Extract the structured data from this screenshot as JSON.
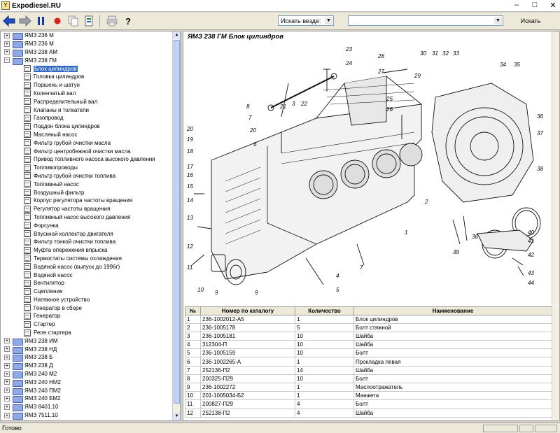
{
  "window": {
    "title": "Expodiesel.RU",
    "icon": "app-icon",
    "controls": [
      "minimize",
      "maximize",
      "close"
    ]
  },
  "toolbar": {
    "buttons": [
      "back-arrow-icon",
      "forward-arrow-icon",
      "pause-icon",
      "record-icon",
      "copy-icon",
      "sync-icon",
      "print-icon",
      "help-icon"
    ],
    "search_scope_label": "Искать везде:",
    "search_value": "",
    "search_button": "Искать"
  },
  "tree": {
    "groups_before": [
      "ЯМЗ 236 М",
      "ЯМЗ 236 М",
      "ЯМЗ 238 АМ"
    ],
    "expanded_group": "ЯМЗ 238 ГМ",
    "children": [
      "Блок цилиндров",
      "Головка цилиндров",
      "Поршень и шатун",
      "Коленчатый вал",
      "Распределительный вал",
      "Клапаны и толкатели",
      "Газопровод",
      "Поддон блока цилиндров",
      "Масляный насос",
      "Фильтр грубой очистки масла",
      "Фильтр центробежной очистки масла",
      "Привод топливного насоса высокого давления",
      "Топливопроводы",
      "Фильтр грубой очистки топлива",
      "Топливный насос",
      "Воздушный фильтр",
      "Корпус регулятора частоты вращения",
      "Регулятор частоты вращения",
      "Топливный насос высокого давления",
      "Форсунка",
      "Впускной коллектор двигателя",
      "Фильтр тонкой очистки топлива",
      "Муфта опережения впрыска",
      "Термостаты системы охлаждения",
      "Водяной насос (выпуск до 1996г)",
      "Водяной насос",
      "Вентилятор",
      "Сцепление",
      "Натяжное устройство",
      "Генератор в сборе",
      "Генератор",
      "Стартер",
      "Реле стартера"
    ],
    "selected_index": 0,
    "groups_after": [
      "ЯМЗ 238 ИМ",
      "ЯМЗ 238 НД",
      "ЯМЗ 238 Б",
      "ЯМЗ 238 Д",
      "ЯМЗ 240 М2",
      "ЯМЗ 240 НМ2",
      "ЯМЗ 240 ПМ2",
      "ЯМЗ 240 БМ2",
      "ЯМЗ 8401.10",
      "ЯМЗ 7511.10"
    ]
  },
  "diagram": {
    "title": "ЯМЗ 238 ГМ  Блок цилиндров",
    "callouts_left": [
      "20",
      "19",
      "18",
      "17",
      "16",
      "15",
      "14",
      "13",
      "12",
      "11",
      "10",
      "9"
    ],
    "callouts_top": [
      "23",
      "24",
      "28",
      "27",
      "29",
      "30",
      "31",
      "32",
      "33",
      "34",
      "35",
      "22",
      "3",
      "21",
      "8",
      "7",
      "25",
      "26",
      "20",
      "6"
    ],
    "callouts_right": [
      "36",
      "37",
      "38",
      "40",
      "41",
      "42",
      "43",
      "44",
      "39",
      "36",
      "2",
      "1",
      "4",
      "5",
      "7",
      "9"
    ]
  },
  "parts_table": {
    "headers": [
      "№",
      "Номер по каталогу",
      "Количество",
      "Наименование"
    ],
    "rows": [
      [
        "1",
        "236-1002012-А5",
        "1",
        "Блок цилиндров"
      ],
      [
        "2",
        "236-1005178",
        "5",
        "Болт стяжной"
      ],
      [
        "3",
        "236-1005181",
        "10",
        "Шайба"
      ],
      [
        "4",
        "312304-П",
        "10",
        "Шайба"
      ],
      [
        "5",
        "236-1005159",
        "10",
        "Болт"
      ],
      [
        "6",
        "236-1002265-А",
        "1",
        "Прокладка левая"
      ],
      [
        "7",
        "252136-П2",
        "14",
        "Шайба"
      ],
      [
        "8",
        "200325-П29",
        "10",
        "Болт"
      ],
      [
        "9",
        "236-1002272",
        "1",
        "Маслоотражатель"
      ],
      [
        "10",
        "201-1005034-Б2",
        "1",
        "Манжета"
      ],
      [
        "11",
        "200827-П29",
        "4",
        "Болт"
      ],
      [
        "12",
        "252138-П2",
        "4",
        "Шайба"
      ]
    ]
  },
  "status": {
    "text": "Готово"
  }
}
